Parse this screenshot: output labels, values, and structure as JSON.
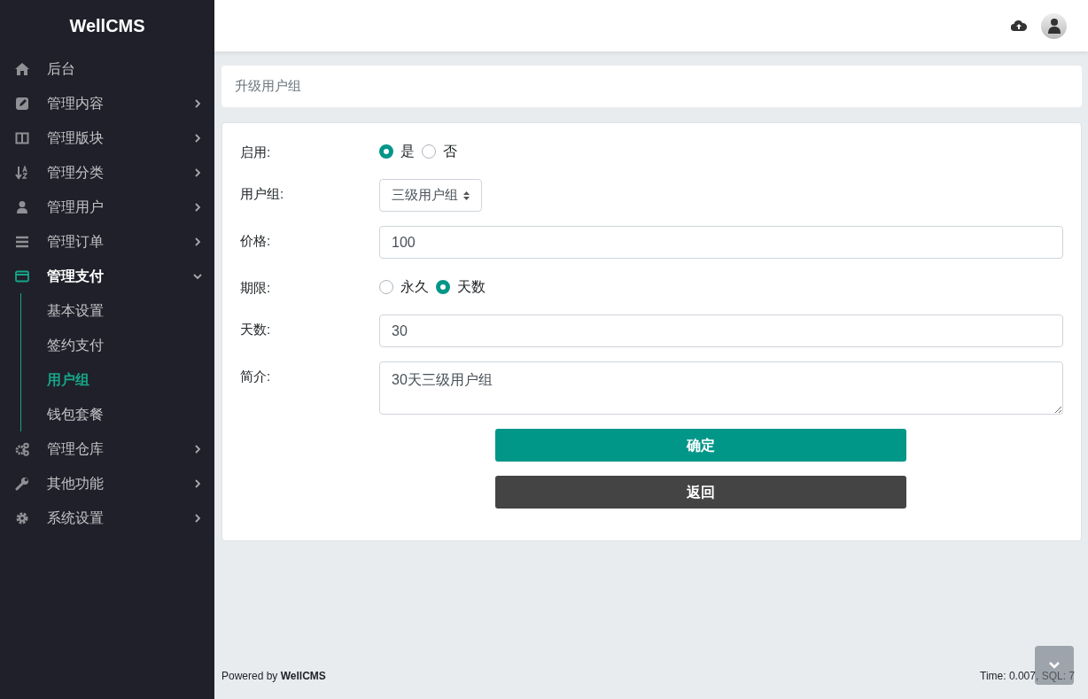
{
  "sidebar": {
    "brand": "WellCMS",
    "items": [
      {
        "label": "后台",
        "expanded": false
      },
      {
        "label": "管理内容",
        "expanded": false
      },
      {
        "label": "管理版块",
        "expanded": false
      },
      {
        "label": "管理分类",
        "expanded": false
      },
      {
        "label": "管理用户",
        "expanded": false
      },
      {
        "label": "管理订单",
        "expanded": false
      },
      {
        "label": "管理支付",
        "expanded": true,
        "children": [
          {
            "label": "基本设置",
            "selected": false
          },
          {
            "label": "签约支付",
            "selected": false
          },
          {
            "label": "用户组",
            "selected": true
          },
          {
            "label": "钱包套餐",
            "selected": false
          }
        ]
      },
      {
        "label": "管理仓库",
        "expanded": false
      },
      {
        "label": "其他功能",
        "expanded": false
      },
      {
        "label": "系统设置",
        "expanded": false
      }
    ]
  },
  "breadcrumb": "升级用户组",
  "form": {
    "fields": [
      {
        "kind": "radio",
        "label": "启用:",
        "options": [
          {
            "label": "是",
            "selected": true
          },
          {
            "label": "否",
            "selected": false
          }
        ]
      },
      {
        "kind": "select",
        "label": "用户组:",
        "value": "三级用户组"
      },
      {
        "kind": "input",
        "label": "价格:",
        "value": "100"
      },
      {
        "kind": "radio",
        "label": "期限:",
        "options": [
          {
            "label": "永久",
            "selected": false
          },
          {
            "label": "天数",
            "selected": true
          }
        ]
      },
      {
        "kind": "input",
        "label": "天数:",
        "value": "30"
      },
      {
        "kind": "textarea",
        "label": "简介:",
        "value": "30天三级用户组"
      }
    ],
    "buttons": [
      {
        "label": "确定",
        "kind": "primary"
      },
      {
        "label": "返回",
        "kind": "secondary"
      }
    ]
  },
  "footer": {
    "powered_by": "Powered by **WellCMS**",
    "stats": "Time: 0.007, SQL: 7"
  }
}
